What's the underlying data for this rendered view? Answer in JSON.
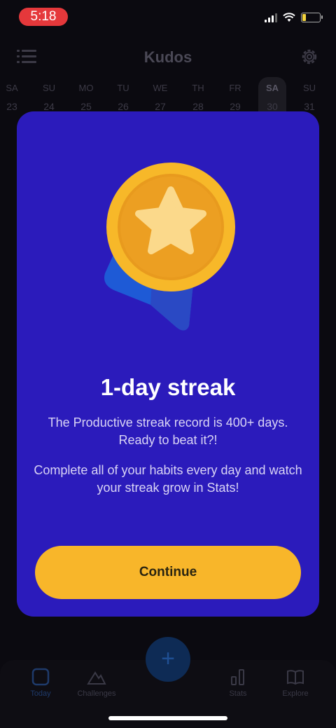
{
  "status_bar": {
    "time": "5:18"
  },
  "header": {
    "title": "Kudos",
    "menu_icon": "menu-list-icon",
    "settings_icon": "gear-icon"
  },
  "calendar": {
    "days": [
      {
        "name": "SA",
        "date": "23"
      },
      {
        "name": "SU",
        "date": "24"
      },
      {
        "name": "MO",
        "date": "25"
      },
      {
        "name": "TU",
        "date": "26"
      },
      {
        "name": "WE",
        "date": "27"
      },
      {
        "name": "TH",
        "date": "28"
      },
      {
        "name": "FR",
        "date": "29"
      },
      {
        "name": "SA",
        "date": "30",
        "active": true
      },
      {
        "name": "SU",
        "date": "31"
      }
    ]
  },
  "modal": {
    "title": "1-day streak",
    "message_1": "The Productive streak record is 400+ days. Ready to beat it?!",
    "message_2": "Complete all of your habits every day and watch your streak grow in Stats!",
    "continue_label": "Continue",
    "medal_icon": "star-medal-icon"
  },
  "tab_bar": {
    "tabs": [
      {
        "label": "Today",
        "icon": "today-icon",
        "active": true
      },
      {
        "label": "Challenges",
        "icon": "mountain-icon"
      },
      {
        "label": "Stats",
        "icon": "bar-chart-icon"
      },
      {
        "label": "Explore",
        "icon": "book-icon"
      }
    ],
    "add_label": "+"
  },
  "colors": {
    "modal_bg": "#2b1bbb",
    "button": "#f8b62a",
    "medal_gold": "#f5b82e",
    "ribbon_blue": "#1e5ad6"
  }
}
